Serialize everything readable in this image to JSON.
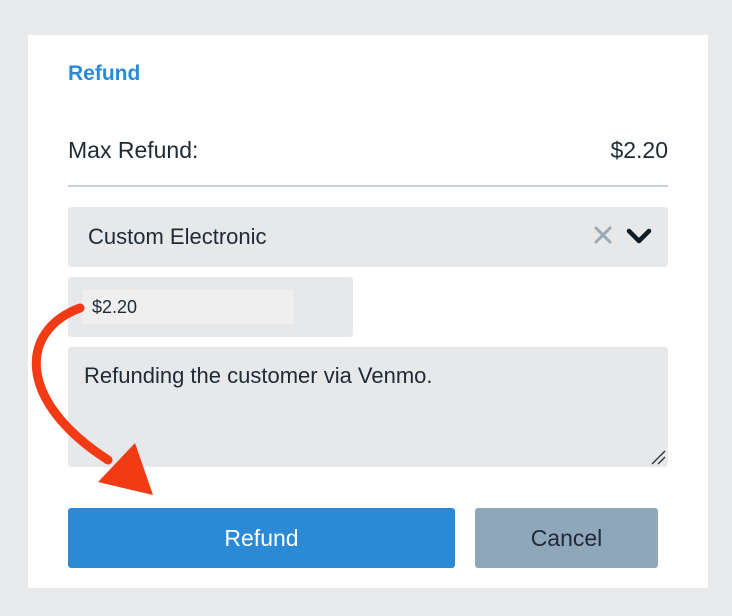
{
  "dialog": {
    "title": "Refund",
    "max_refund_label": "Max Refund:",
    "max_refund_value": "$2.20"
  },
  "method_select": {
    "selected": "Custom Electronic",
    "clear_icon": "x-icon",
    "chevron_icon": "chevron-down-icon"
  },
  "amount": {
    "value": "$2.20"
  },
  "note": {
    "value": "Refunding the customer via Venmo."
  },
  "buttons": {
    "refund_label": "Refund",
    "cancel_label": "Cancel"
  },
  "colors": {
    "accent": "#2a8ad6",
    "cancel": "#8fa7bb",
    "annotation_arrow": "#f23a14"
  }
}
